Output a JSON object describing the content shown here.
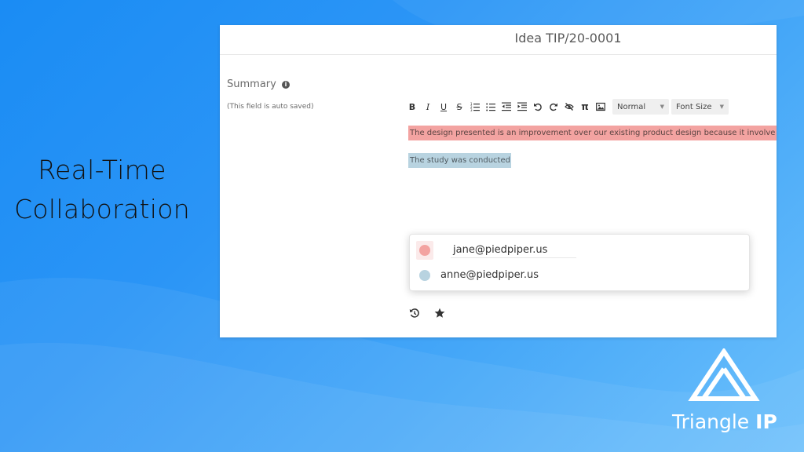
{
  "slide": {
    "headline_line1": "Real-Time",
    "headline_line2": "Collaboration"
  },
  "card": {
    "title": "Idea TIP/20-0001",
    "field_label": "Summary",
    "field_note": "(This field is auto saved)"
  },
  "toolbar": {
    "bold": "B",
    "italic": "I",
    "underline": "U",
    "strikethrough": "S",
    "pi": "π",
    "format_select": "Normal",
    "font_size_select": "Font Size"
  },
  "editor": {
    "line1": "The design presented is an improvement over our existing product design because it involve",
    "line2": "The study was conducted",
    "line1_color": "#f3a3a1",
    "line2_color": "#b8d3e0"
  },
  "collaborators": [
    {
      "email": "jane@piedpiper.us",
      "color": "#f3a3a1"
    },
    {
      "email": "anne@piedpiper.us",
      "color": "#b8d3e0"
    }
  ],
  "brand": {
    "name_part1": "Triangle ",
    "name_part2": "IP"
  },
  "icons": {
    "history": "history-icon",
    "star": "star-icon",
    "logo": "triangle-logo-icon"
  }
}
